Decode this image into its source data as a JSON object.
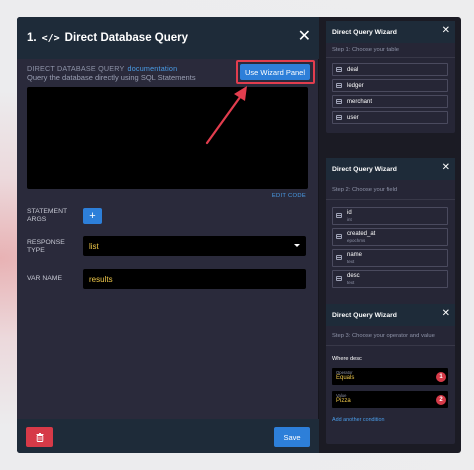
{
  "modal": {
    "number": "1.",
    "title": "Direct Database Query",
    "code_icon": "</>",
    "section_title": "DIRECT DATABASE QUERY",
    "doc_link": "documentation",
    "description": "Query the database directly using SQL Statements",
    "wizard_button": "Use Wizard Panel",
    "edit_code": "EDIT CODE",
    "statement_args_label": "STATEMENT ARGS",
    "add_button": "+",
    "response_type_label": "RESPONSE TYPE",
    "response_type_value": "list",
    "var_name_label": "VAR NAME",
    "var_name_value": "results",
    "save_button": "Save",
    "icons": {
      "close": "close-icon",
      "code": "code-icon",
      "delete": "trash-icon",
      "caret": "chevron-down-icon"
    }
  },
  "wizard1": {
    "title": "Direct Query Wizard",
    "step": "Step 1: Choose your table",
    "tables": [
      "deal",
      "ledger",
      "merchant",
      "user"
    ]
  },
  "wizard2": {
    "title": "Direct Query Wizard",
    "step": "Step 2: Choose your field",
    "fields": [
      {
        "name": "id",
        "type": "int"
      },
      {
        "name": "created_at",
        "type": "epochms"
      },
      {
        "name": "name",
        "type": "text"
      },
      {
        "name": "desc",
        "type": "text"
      }
    ]
  },
  "wizard3": {
    "title": "Direct Query Wizard",
    "step": "Step 3: Choose your operator and value",
    "where": "Where desc",
    "operator_label": "Operator",
    "operator_value": "Equals",
    "value_label": "Value",
    "value_value": "Pizza",
    "badge1": "1",
    "badge2": "2",
    "add_condition": "Add another condition"
  },
  "colors": {
    "accent_blue": "#2d7fd9",
    "danger_red": "#d63a48",
    "highlight_red": "#e23d4e",
    "value_yellow": "#f0c94a"
  }
}
